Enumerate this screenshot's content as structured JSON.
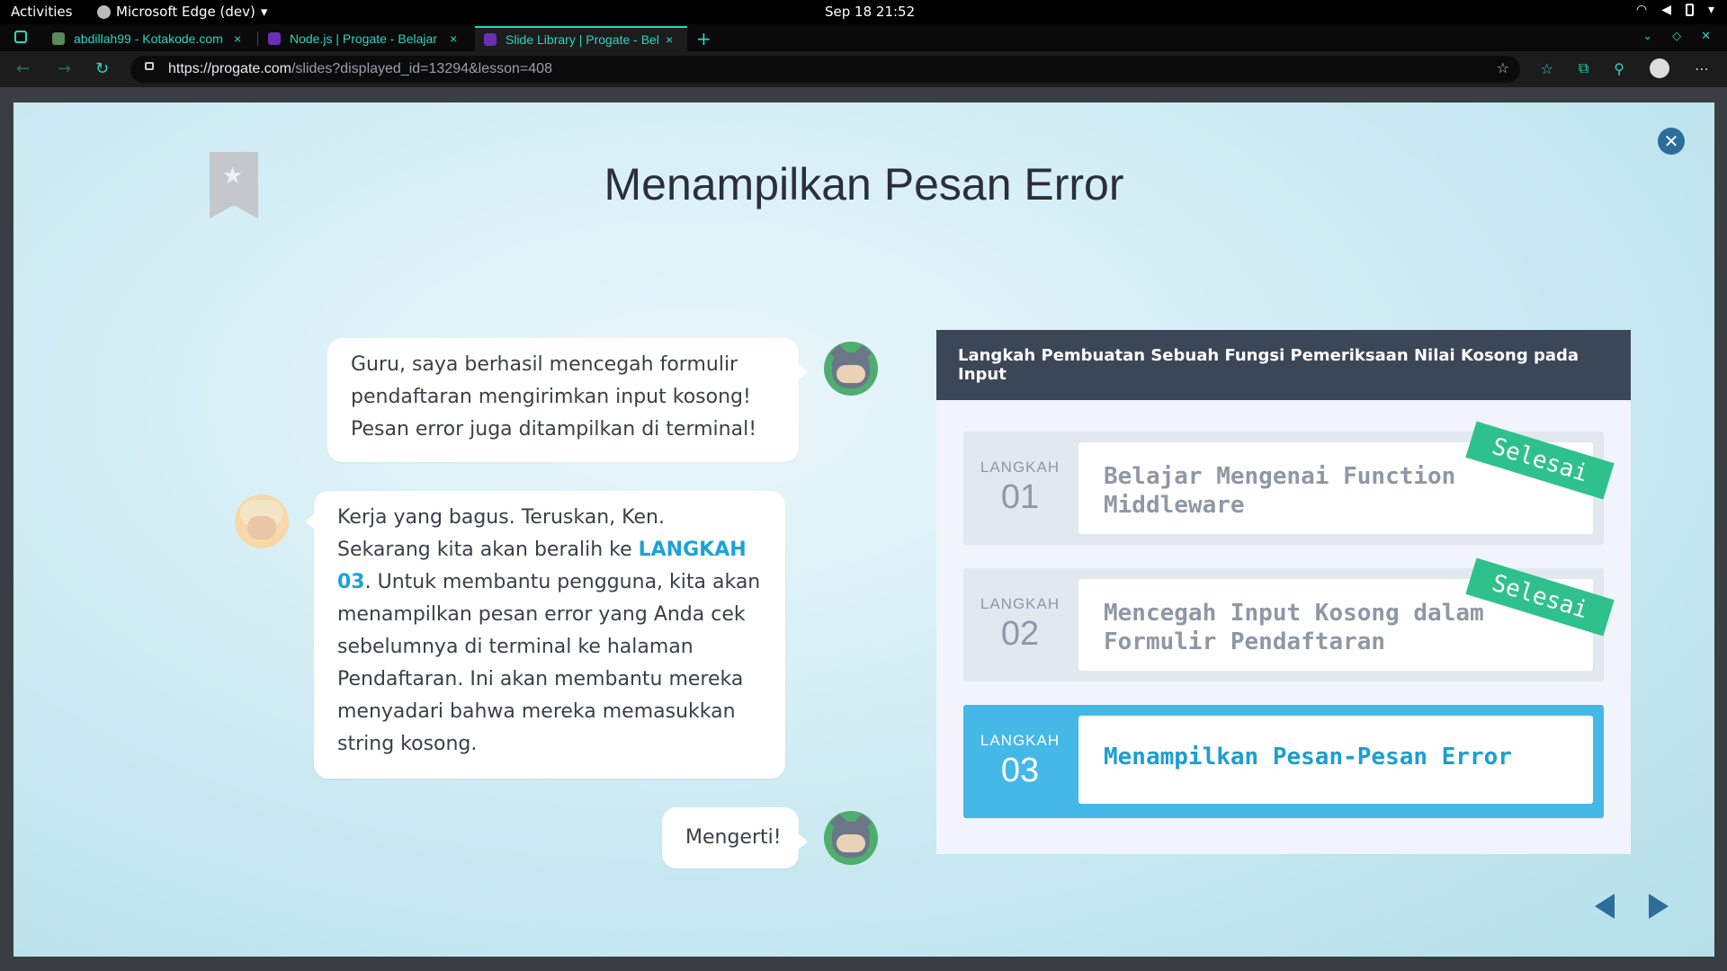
{
  "system": {
    "activities": "Activities",
    "app_name": "Microsoft Edge (dev)",
    "datetime": "Sep 18  21:52"
  },
  "browser": {
    "tabs": [
      {
        "title": "abdillah99 - Kotakode.com",
        "close": "×"
      },
      {
        "title": "Node.js | Progate - Belajar",
        "close": "×"
      },
      {
        "title": "Slide Library | Progate - Belajar",
        "close": "×"
      }
    ],
    "new_tab": "+",
    "url_host": "https://progate.com",
    "url_path": "/slides?displayed_id=13294&lesson=408"
  },
  "slide": {
    "title": "Menampilkan Pesan Error",
    "close": "✕",
    "messages": [
      {
        "speaker": "Ken",
        "text": "Guru, saya berhasil mencegah formulir pendaftaran mengirimkan input kosong! Pesan error juga ditampilkan di terminal!"
      },
      {
        "speaker": "Guru",
        "text_before": "Kerja yang bagus. Teruskan, Ken. Sekarang kita akan beralih ke ",
        "highlight": "LANGKAH 03",
        "text_after": ". Untuk membantu pengguna, kita akan menampilkan pesan error yang Anda cek sebelumnya di terminal ke halaman Pendaftaran. Ini akan membantu mereka menyadari bahwa mereka memasukkan string kosong."
      },
      {
        "speaker": "Ken",
        "text": "Mengerti!"
      }
    ],
    "steps_panel": {
      "heading": "Langkah Pembuatan Sebuah Fungsi Pemeriksaan Nilai Kosong pada Input",
      "steps": [
        {
          "label": "LANGKAH",
          "number": "01",
          "title": "Belajar Mengenai Function Middleware",
          "badge": "Selesai",
          "state": "done"
        },
        {
          "label": "LANGKAH",
          "number": "02",
          "title": "Mencegah Input Kosong dalam Formulir Pendaftaran",
          "badge": "Selesai",
          "state": "done"
        },
        {
          "label": "LANGKAH",
          "number": "03",
          "title": "Menampilkan Pesan-Pesan Error",
          "badge": "",
          "state": "active"
        }
      ]
    },
    "colors": {
      "accent": "#44b8e6",
      "done_badge": "#2fc18b",
      "panel_header": "#3b4656",
      "nav_arrow": "#2c6d9c"
    }
  }
}
